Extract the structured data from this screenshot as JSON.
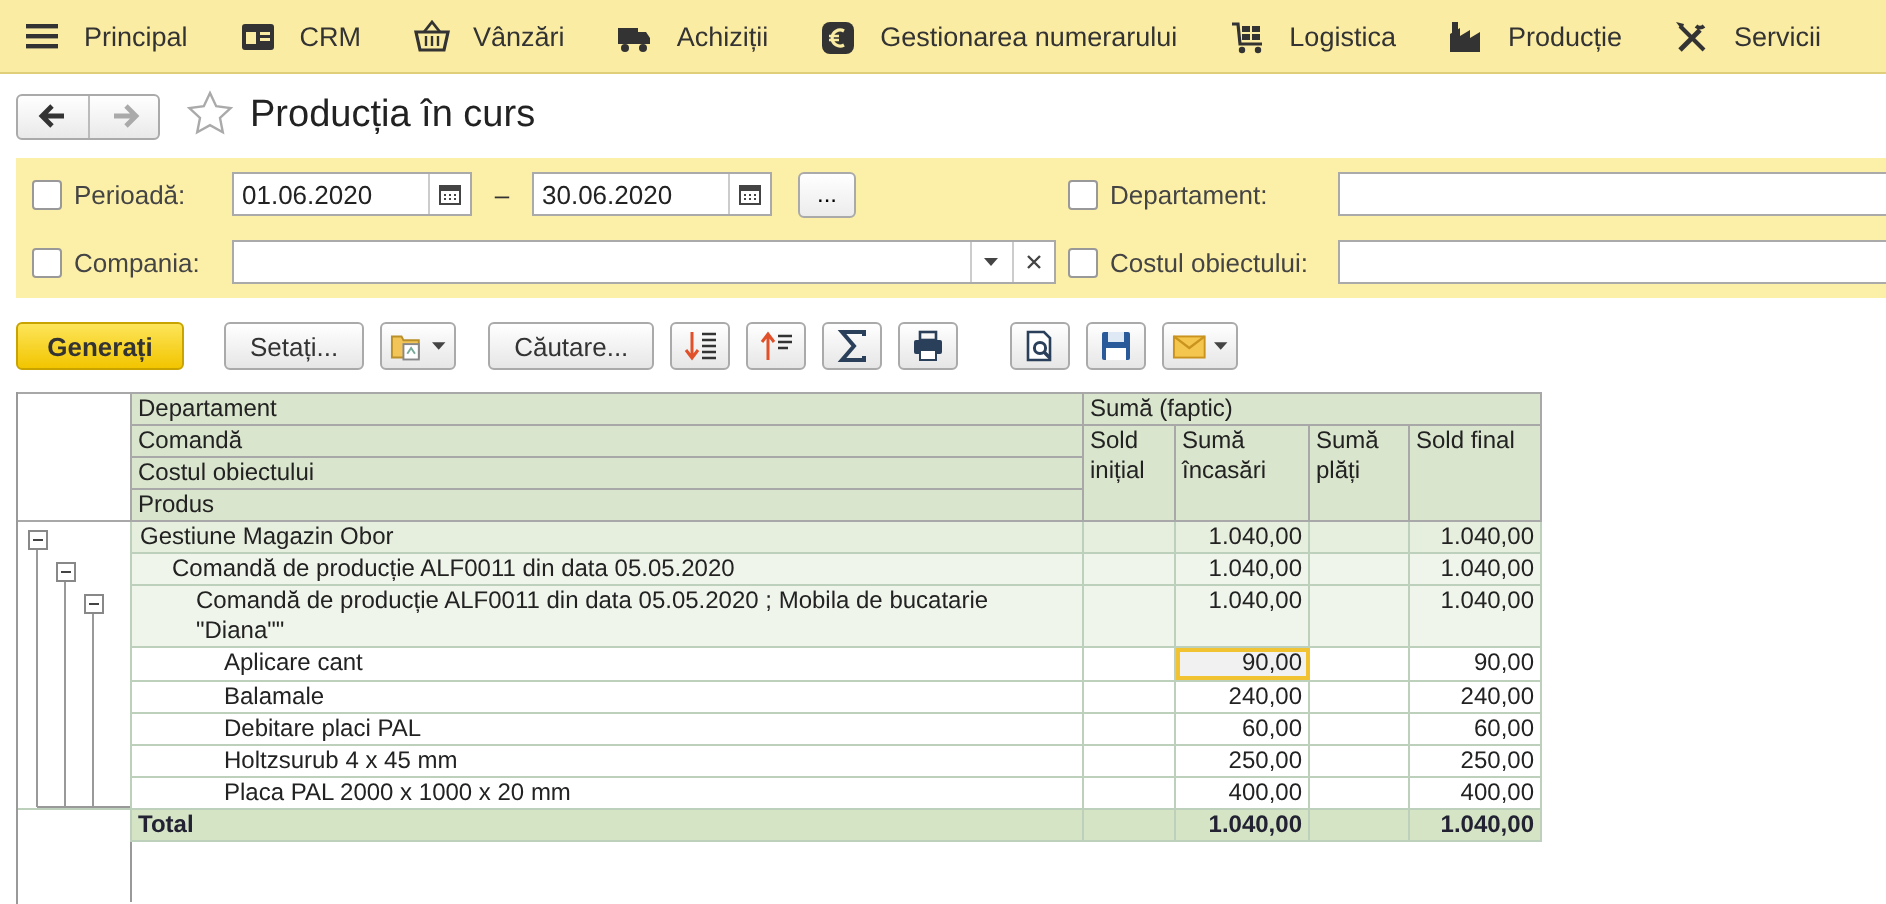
{
  "menu": [
    {
      "label": "Principal"
    },
    {
      "label": "CRM"
    },
    {
      "label": "Vânzări"
    },
    {
      "label": "Achiziții"
    },
    {
      "label": "Gestionarea numerarului"
    },
    {
      "label": "Logistica"
    },
    {
      "label": "Producție"
    },
    {
      "label": "Servicii"
    }
  ],
  "navigation": {
    "back": {
      "disabled": false
    },
    "forward": {
      "disabled": true
    }
  },
  "window": {
    "title": "Producția în curs",
    "favorite": false
  },
  "filters": {
    "period": {
      "label": "Perioadă:",
      "checked": false,
      "from": "01.06.2020",
      "to": "30.06.2020",
      "separator": "–",
      "more": "..."
    },
    "company": {
      "label": "Compania:",
      "checked": false
    },
    "department": {
      "label": "Departament:",
      "checked": false
    },
    "cost_object": {
      "label": "Costul obiectului:",
      "checked": false
    }
  },
  "toolbar": [
    {
      "kind": "primary",
      "label": "Generați"
    },
    {
      "kind": "text",
      "label": "Setați..."
    },
    {
      "kind": "menu"
    },
    {
      "kind": "text",
      "label": "Căutare..."
    },
    {
      "kind": "icon"
    },
    {
      "kind": "icon"
    },
    {
      "kind": "icon"
    },
    {
      "kind": "icon"
    },
    {
      "kind": "icon"
    },
    {
      "kind": "icon"
    },
    {
      "kind": "menu"
    }
  ],
  "report": {
    "groupings": [
      "Departament",
      "Comandă",
      "Costul obiectului",
      "Produs"
    ],
    "group_header": "Sumă (faptic)",
    "columns": [
      "Sold inițial",
      "Sumă încasări",
      "Sumă plăți",
      "Sold final"
    ],
    "rows": [
      {
        "label": "Gestiune Magazin Obor",
        "expanded": true,
        "cells": [
          {
            "selected": false
          },
          {
            "text": "1.040,00",
            "selected": false
          },
          {
            "selected": false
          },
          {
            "text": "1.040,00",
            "selected": false
          }
        ],
        "children": [
          {
            "label": "Comandă de producție ALF0011 din data 05.05.2020",
            "expanded": true,
            "cells": [
              {
                "selected": false
              },
              {
                "text": "1.040,00",
                "selected": false
              },
              {
                "selected": false
              },
              {
                "text": "1.040,00",
                "selected": false
              }
            ],
            "children": [
              {
                "label": "Comandă de producție ALF0011 din data 05.05.2020 ; Mobila de bucatarie \"Diana\"\"",
                "expanded": true,
                "cells": [
                  {
                    "selected": false
                  },
                  {
                    "text": "1.040,00",
                    "selected": false
                  },
                  {
                    "selected": false
                  },
                  {
                    "text": "1.040,00",
                    "selected": false
                  }
                ],
                "children": [
                  {
                    "label": "Aplicare cant",
                    "cells": [
                      {
                        "selected": false
                      },
                      {
                        "text": "90,00",
                        "selected": true
                      },
                      {
                        "selected": false
                      },
                      {
                        "text": "90,00",
                        "selected": false
                      }
                    ]
                  },
                  {
                    "label": "Balamale",
                    "cells": [
                      {
                        "selected": false
                      },
                      {
                        "text": "240,00",
                        "selected": false
                      },
                      {
                        "selected": false
                      },
                      {
                        "text": "240,00",
                        "selected": false
                      }
                    ]
                  },
                  {
                    "label": "Debitare placi PAL",
                    "cells": [
                      {
                        "selected": false
                      },
                      {
                        "text": "60,00",
                        "selected": false
                      },
                      {
                        "selected": false
                      },
                      {
                        "text": "60,00",
                        "selected": false
                      }
                    ]
                  },
                  {
                    "label": "Holtzsurub 4 x 45 mm",
                    "cells": [
                      {
                        "selected": false
                      },
                      {
                        "text": "250,00",
                        "selected": false
                      },
                      {
                        "selected": false
                      },
                      {
                        "text": "250,00",
                        "selected": false
                      }
                    ]
                  },
                  {
                    "label": "Placa PAL 2000 x 1000 x 20 mm",
                    "cells": [
                      {
                        "selected": false
                      },
                      {
                        "text": "400,00",
                        "selected": false
                      },
                      {
                        "selected": false
                      },
                      {
                        "text": "400,00",
                        "selected": false
                      }
                    ]
                  }
                ]
              }
            ]
          }
        ]
      }
    ],
    "total": {
      "label": "Total",
      "cells": [
        {
          "selected": false
        },
        {
          "text": "1.040,00",
          "selected": false
        },
        {
          "selected": false
        },
        {
          "text": "1.040,00",
          "selected": false
        }
      ]
    }
  }
}
